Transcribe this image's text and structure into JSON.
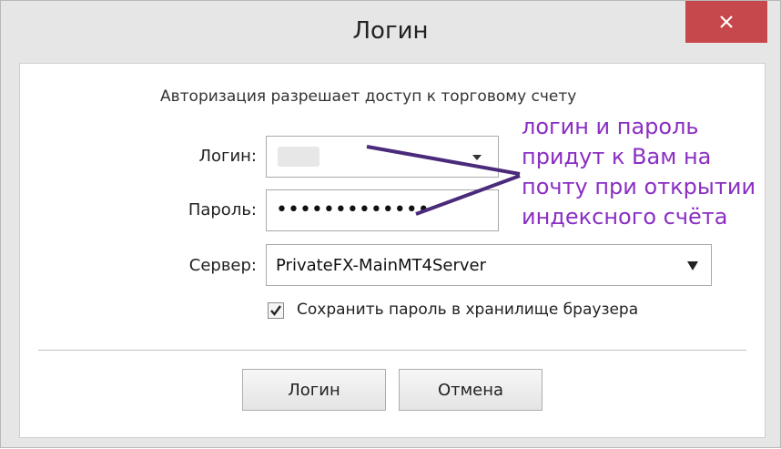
{
  "window": {
    "title": "Логин",
    "close_icon": "close-icon"
  },
  "form": {
    "subtitle": "Авторизация разрешает доступ к торговому счету",
    "login_label": "Логин:",
    "login_value": "",
    "password_label": "Пароль:",
    "password_value": "•••••••••••••",
    "server_label": "Сервер:",
    "server_value": "PrivateFX-MainMT4Server",
    "save_password_label": "Сохранить пароль в хранилище браузера",
    "save_password_checked": true
  },
  "buttons": {
    "login": "Логин",
    "cancel": "Отмена"
  },
  "annotation": {
    "lines": [
      "логин и пароль",
      "придут к Вам на",
      "почту при открытии",
      "индексного счёта"
    ],
    "color": "#8a2fc4",
    "arrow_color": "#4a2a7a"
  },
  "colors": {
    "close_button": "#c7484c"
  }
}
